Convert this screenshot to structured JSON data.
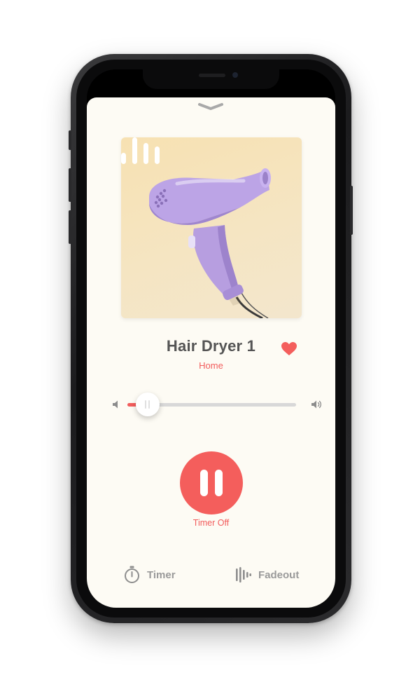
{
  "player": {
    "title": "Hair Dryer 1",
    "category": "Home",
    "favorited": true,
    "volume_level": 0.12,
    "timer_status": "Timer Off"
  },
  "bottom_bar": {
    "timer_label": "Timer",
    "fadeout_label": "Fadeout"
  },
  "icons": {
    "collapse": "chevron-down-icon",
    "favorite": "heart-icon",
    "volume_low": "volume-low-icon",
    "volume_high": "volume-high-icon",
    "playback": "pause-icon",
    "playing_indicator": "sound-bars-icon",
    "timer": "stopwatch-icon",
    "fadeout": "fade-bars-icon"
  },
  "colors": {
    "accent": "#f45e5c",
    "sheet_background": "#fdfbf4",
    "title_text": "#545454",
    "secondary_text": "#9a9a9a",
    "track": "#d8d8d8"
  }
}
